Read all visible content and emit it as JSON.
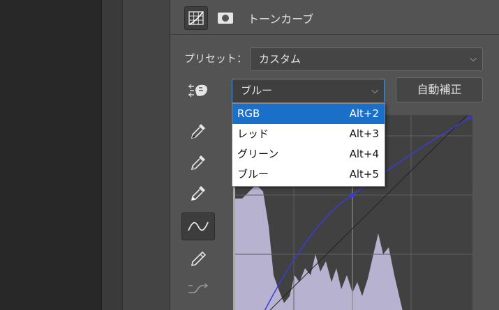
{
  "panel": {
    "title": "トーンカーブ",
    "header_icons": [
      "curves-grid-icon",
      "mask-icon"
    ]
  },
  "preset": {
    "label": "プリセット：",
    "value": "カスタム"
  },
  "channel": {
    "value": "ブルー"
  },
  "auto_button": "自動補正",
  "channel_menu": {
    "items": [
      {
        "label": "RGB",
        "shortcut": "Alt+2",
        "selected": true
      },
      {
        "label": "レッド",
        "shortcut": "Alt+3",
        "selected": false
      },
      {
        "label": "グリーン",
        "shortcut": "Alt+4",
        "selected": false
      },
      {
        "label": "ブルー",
        "shortcut": "Alt+5",
        "selected": false
      }
    ]
  },
  "tools": [
    "on-image-adjust-icon",
    "black-point-eyedropper-icon",
    "gray-point-eyedropper-icon",
    "white-point-eyedropper-icon",
    "curve-point-tool-icon",
    "pencil-icon",
    "smooth-curve-icon"
  ],
  "colors": {
    "curve": "#3b3bdc",
    "histogram": "#b7b2cf",
    "menu_highlight": "#1a6fc9"
  }
}
